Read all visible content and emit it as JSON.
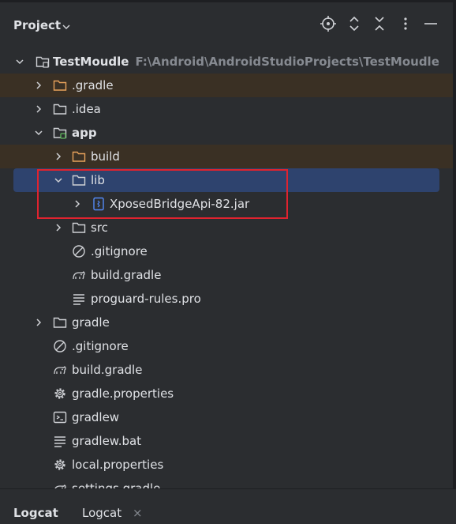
{
  "header": {
    "title": "Project",
    "actions": [
      "locate-icon",
      "expand-collapse-icon",
      "collapse-all-icon",
      "more-options-icon",
      "minimize-icon"
    ]
  },
  "tree": {
    "root": {
      "label": "TestMoudle",
      "path": "F:\\Android\\AndroidStudioProjects\\TestMoudle"
    },
    "dot_gradle": ".gradle",
    "dot_idea": ".idea",
    "app": "app",
    "build_dir": "build",
    "lib": "lib",
    "jar": "XposedBridgeApi-82.jar",
    "src": "src",
    "app_gitignore": ".gitignore",
    "app_build_gradle": "build.gradle",
    "proguard": "proguard-rules.pro",
    "gradle_dir": "gradle",
    "root_gitignore": ".gitignore",
    "root_build_gradle": "build.gradle",
    "gradle_properties": "gradle.properties",
    "gradlew": "gradlew",
    "gradlew_bat": "gradlew.bat",
    "local_properties": "local.properties",
    "settings_gradle": "settings.gradle"
  },
  "bottom_tabs": {
    "logcat_bold": "Logcat",
    "logcat_tab": "Logcat",
    "close_glyph": "×"
  },
  "colors": {
    "background": "#2b2d30",
    "selection": "#2e436e",
    "excluded_highlight": "#3a3024",
    "excluded_folder": "#e7a25b",
    "annotation_box": "#e0232f"
  }
}
